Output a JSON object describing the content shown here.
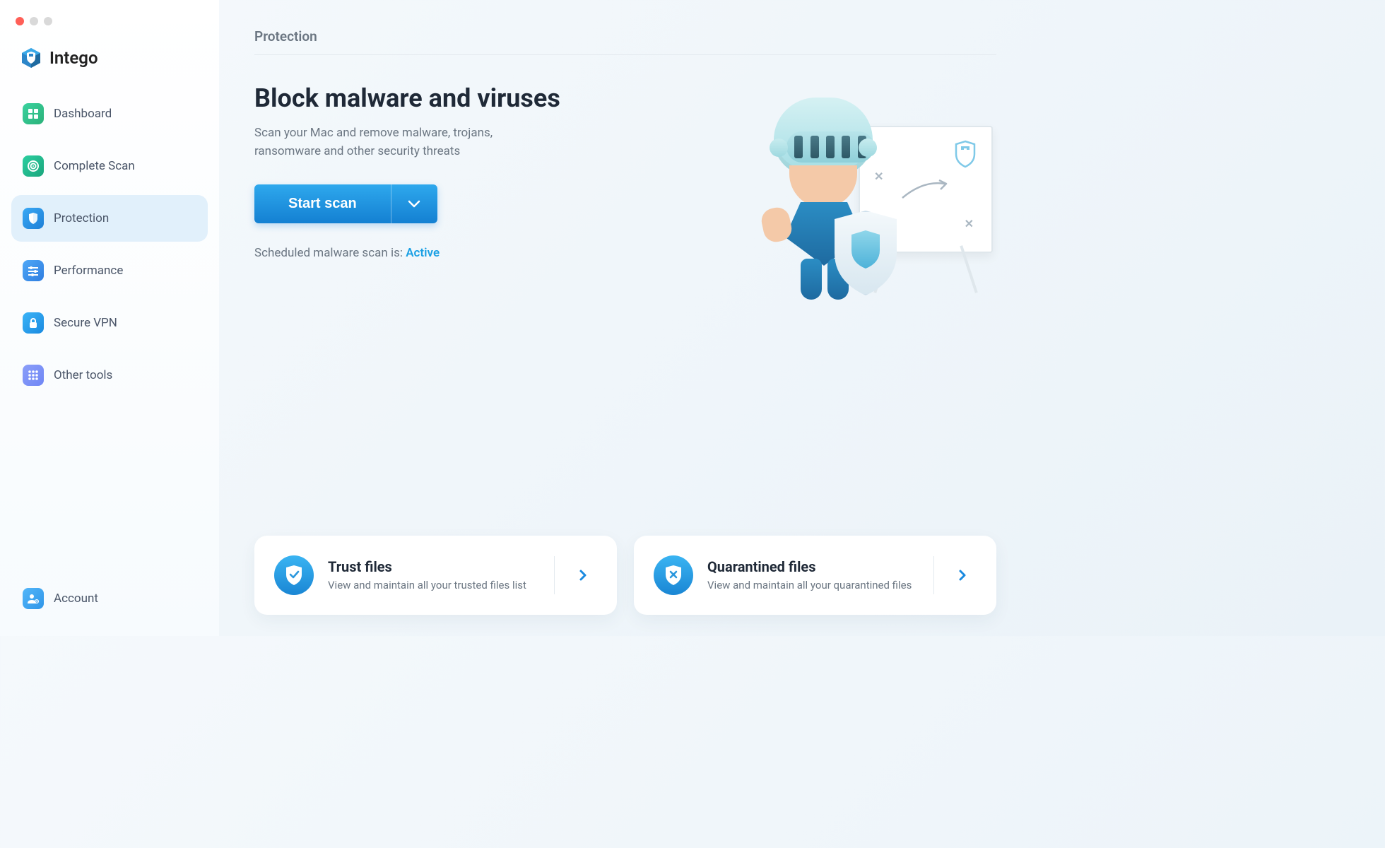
{
  "brand": {
    "name": "Intego"
  },
  "sidebar": {
    "items": [
      {
        "label": "Dashboard"
      },
      {
        "label": "Complete Scan"
      },
      {
        "label": "Protection"
      },
      {
        "label": "Performance"
      },
      {
        "label": "Secure VPN"
      },
      {
        "label": "Other tools"
      }
    ],
    "footer": {
      "label": "Account"
    }
  },
  "page": {
    "title": "Protection",
    "heading": "Block malware and viruses",
    "subheading": "Scan your Mac and remove malware, trojans, ransomware and other security threats",
    "scan_button_label": "Start scan",
    "status_prefix": "Scheduled malware scan is: ",
    "status_value": "Active"
  },
  "cards": {
    "trust": {
      "title": "Trust files",
      "subtitle": "View and maintain all your trusted files list"
    },
    "quarantine": {
      "title": "Quarantined files",
      "subtitle": "View and maintain all your quarantined files"
    }
  }
}
